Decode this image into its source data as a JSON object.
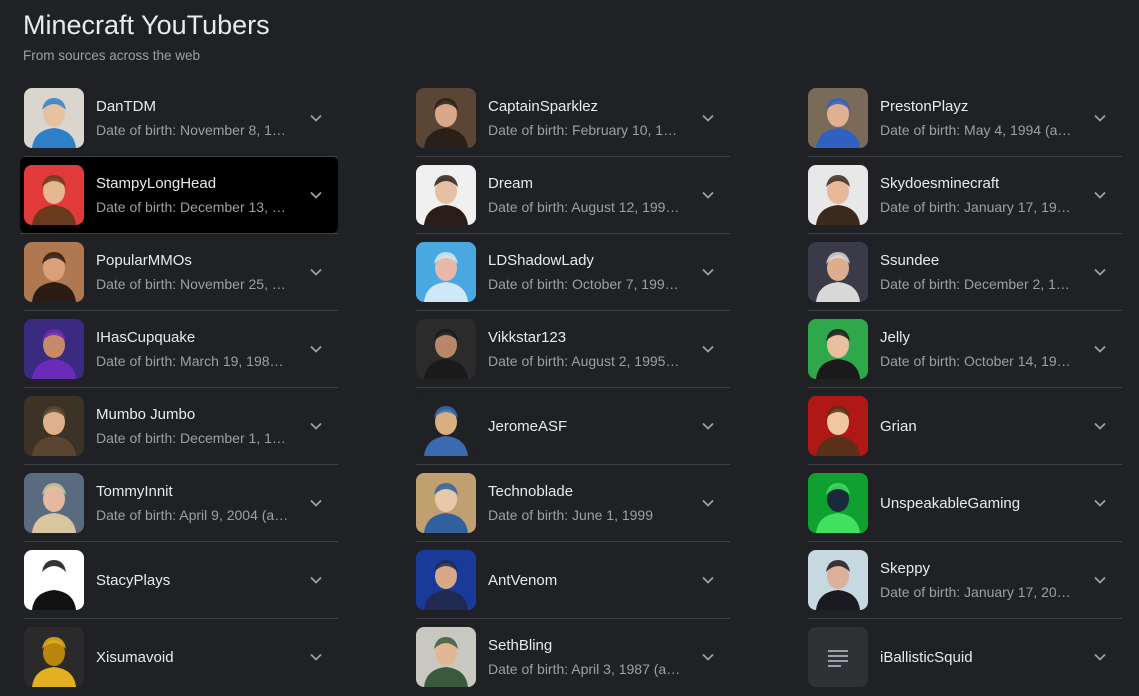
{
  "header": {
    "title": "Minecraft YouTubers",
    "subtitle": "From sources across the web"
  },
  "columns": [
    [
      {
        "name": "DanTDM",
        "dob": "Date of birth: November 8, 1…",
        "avatar": [
          "#d9d6d0",
          "#2f7fc6",
          "#e6c2a0"
        ]
      },
      {
        "name": "StampyLongHead",
        "dob": "Date of birth: December 13, …",
        "avatar": [
          "#e23a3a",
          "#6b3a1e",
          "#e6b892"
        ]
      },
      {
        "name": "PopularMMOs",
        "dob": "Date of birth: November 25, …",
        "avatar": [
          "#b07850",
          "#2a1c14",
          "#d9a07a"
        ]
      },
      {
        "name": "IHasCupquake",
        "dob": "Date of birth: March 19, 198…",
        "avatar": [
          "#3a2a80",
          "#6a2bb8",
          "#c98a6a"
        ]
      },
      {
        "name": "Mumbo Jumbo",
        "dob": "Date of birth: December 1, 1…",
        "avatar": [
          "#3d3226",
          "#5a4630",
          "#e0b08a"
        ]
      },
      {
        "name": "TommyInnit",
        "dob": "Date of birth: April 9, 2004 (a…",
        "avatar": [
          "#5a6b80",
          "#d7c6a0",
          "#e5b8a0"
        ]
      },
      {
        "name": "StacyPlays",
        "dob": "",
        "avatar": [
          "#ffffff",
          "#111111",
          "#ffffff"
        ]
      },
      {
        "name": "Xisumavoid",
        "dob": "",
        "avatar": [
          "#2a2a2a",
          "#e3b020",
          "#b8850f"
        ]
      }
    ],
    [
      {
        "name": "CaptainSparklez",
        "dob": "Date of birth: February 10, 1…",
        "avatar": [
          "#5b4535",
          "#2a201a",
          "#d8a888"
        ]
      },
      {
        "name": "Dream",
        "dob": "Date of birth: August 12, 199…",
        "avatar": [
          "#f0f0f0",
          "#2b1e18",
          "#e6c0a4"
        ]
      },
      {
        "name": "LDShadowLady",
        "dob": "Date of birth: October 7, 199…",
        "avatar": [
          "#4aa8e0",
          "#d0e8f5",
          "#e8b8a8"
        ]
      },
      {
        "name": "Vikkstar123",
        "dob": "Date of birth: August 2, 1995…",
        "avatar": [
          "#2b2b2b",
          "#1a1a1a",
          "#b8866a"
        ]
      },
      {
        "name": "JeromeASF",
        "dob": "",
        "avatar": [
          "#202124",
          "#3a6ab0",
          "#d8b080"
        ]
      },
      {
        "name": "Technoblade",
        "dob": "Date of birth: June 1, 1999",
        "avatar": [
          "#c0a070",
          "#3060a0",
          "#e8c8a8"
        ]
      },
      {
        "name": "AntVenom",
        "dob": "",
        "avatar": [
          "#1a3a9a",
          "#202a50",
          "#d8a888"
        ]
      },
      {
        "name": "SethBling",
        "dob": "Date of birth: April 3, 1987 (a…",
        "avatar": [
          "#c8c8c0",
          "#3a5a40",
          "#e0b896"
        ]
      }
    ],
    [
      {
        "name": "PrestonPlayz",
        "dob": "Date of birth: May 4, 1994 (a…",
        "avatar": [
          "#7a6a5a",
          "#3060c0",
          "#e0b090"
        ]
      },
      {
        "name": "Skydoesminecraft",
        "dob": "Date of birth: January 17, 19…",
        "avatar": [
          "#e8e8e8",
          "#3a2a1e",
          "#e8b898"
        ]
      },
      {
        "name": "Ssundee",
        "dob": "Date of birth: December 2, 1…",
        "avatar": [
          "#3a3a48",
          "#d8d8d8",
          "#dcae90"
        ]
      },
      {
        "name": "Jelly",
        "dob": "Date of birth: October 14, 19…",
        "avatar": [
          "#2ea84a",
          "#1a1a1a",
          "#e8c0a0"
        ]
      },
      {
        "name": "Grian",
        "dob": "",
        "avatar": [
          "#b01818",
          "#5a3018",
          "#f0c8a0"
        ]
      },
      {
        "name": "UnspeakableGaming",
        "dob": "",
        "avatar": [
          "#10a030",
          "#40e060",
          "#1a2a3a"
        ]
      },
      {
        "name": "Skeppy",
        "dob": "Date of birth: January 17, 20…",
        "avatar": [
          "#c8d8e0",
          "#1a1a20",
          "#dcb09a"
        ]
      },
      {
        "name": "iBallisticSquid",
        "dob": "",
        "avatar": [
          "#303134",
          "#9aa0a6",
          "#303134"
        ],
        "placeholder": true
      }
    ]
  ],
  "selected": "StampyLongHead",
  "icons": {
    "expand": "chevron-down-icon"
  }
}
